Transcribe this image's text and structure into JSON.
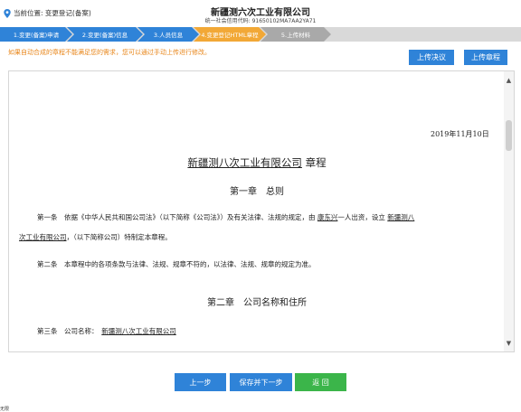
{
  "header": {
    "location": "当前位置: 变更登记(备案)",
    "company": "新疆测六次工业有限公司",
    "credit_code": "统一社会信用代码: 91650102MA7AA2YA71"
  },
  "steps": [
    {
      "label": "1.变更(备案)申请",
      "state": "done"
    },
    {
      "label": "2.变更(备案)信息",
      "state": "done"
    },
    {
      "label": "3.人员信息",
      "state": "done"
    },
    {
      "label": "4.变更登记HTML章程",
      "state": "current"
    },
    {
      "label": "5.上传材料",
      "state": "todo"
    }
  ],
  "notice": "如果自动合成的章程不能满足您的需求，您可以通过手动上传进行修改。",
  "buttons": {
    "upload_resolution": "上传决议",
    "upload_charter": "上传章程",
    "prev": "上一步",
    "save_next": "保存并下一步",
    "back": "返 回"
  },
  "document": {
    "date": "2019年11月10日",
    "title_company": "新疆测八次工业有限公司",
    "title_suffix": " 章程",
    "chapter1": "第一章　总则",
    "article1_a": "第一条　依据《中华人民共和国公司法》（以下简称《公司法》）及有关法律、法规的规定，由 ",
    "article1_person": "康东兴",
    "article1_b": "一人出资，设立 ",
    "article1_company_1": "新疆测八",
    "article1_company_2": "次工业有限公司",
    "article1_c": "，（以下简称公司）特制定本章程。",
    "article2": "第二条　本章程中的各项条款与法律、法规、规章不符的，以法律、法规、规章的规定为准。",
    "chapter2": "第二章　公司名称和住所",
    "article3_label": "第三条　公司名称：",
    "article3_value": "新疆测八次工业有限公司"
  },
  "footer_label": "无限"
}
